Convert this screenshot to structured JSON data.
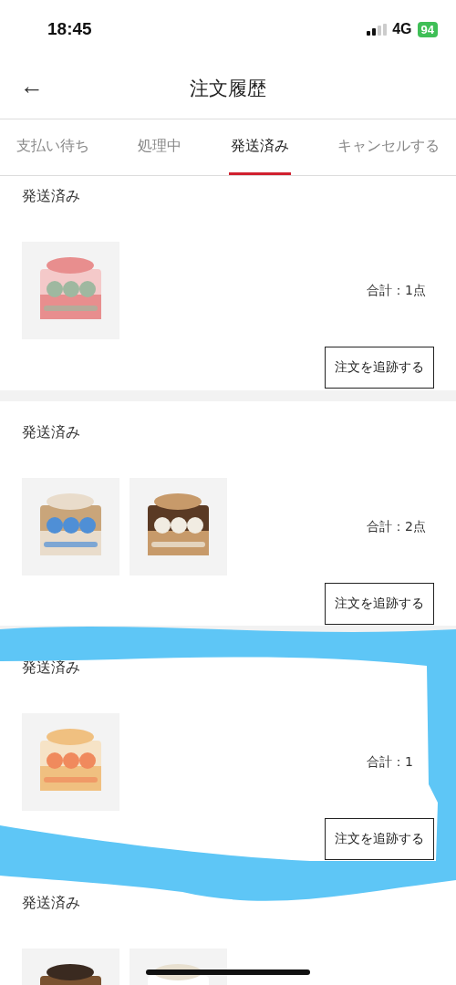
{
  "status_bar": {
    "time": "18:45",
    "network": "4G",
    "battery": "94"
  },
  "header": {
    "back": "←",
    "title": "注文履歴"
  },
  "tabs": [
    {
      "label": "支払い待ち",
      "selected": false
    },
    {
      "label": "処理中",
      "selected": false
    },
    {
      "label": "発送済み",
      "selected": true
    },
    {
      "label": "キャンセルする",
      "selected": false
    }
  ],
  "orders": [
    {
      "status": "発送済み",
      "total": "合計：1点",
      "button": "注文を追跡する"
    },
    {
      "status": "発送済み",
      "total": "合計：2点",
      "button": "注文を追跡する"
    },
    {
      "status": "発送済み",
      "total": "合計：1",
      "button": "注文を追跡する"
    },
    {
      "status": "発送済み"
    }
  ]
}
